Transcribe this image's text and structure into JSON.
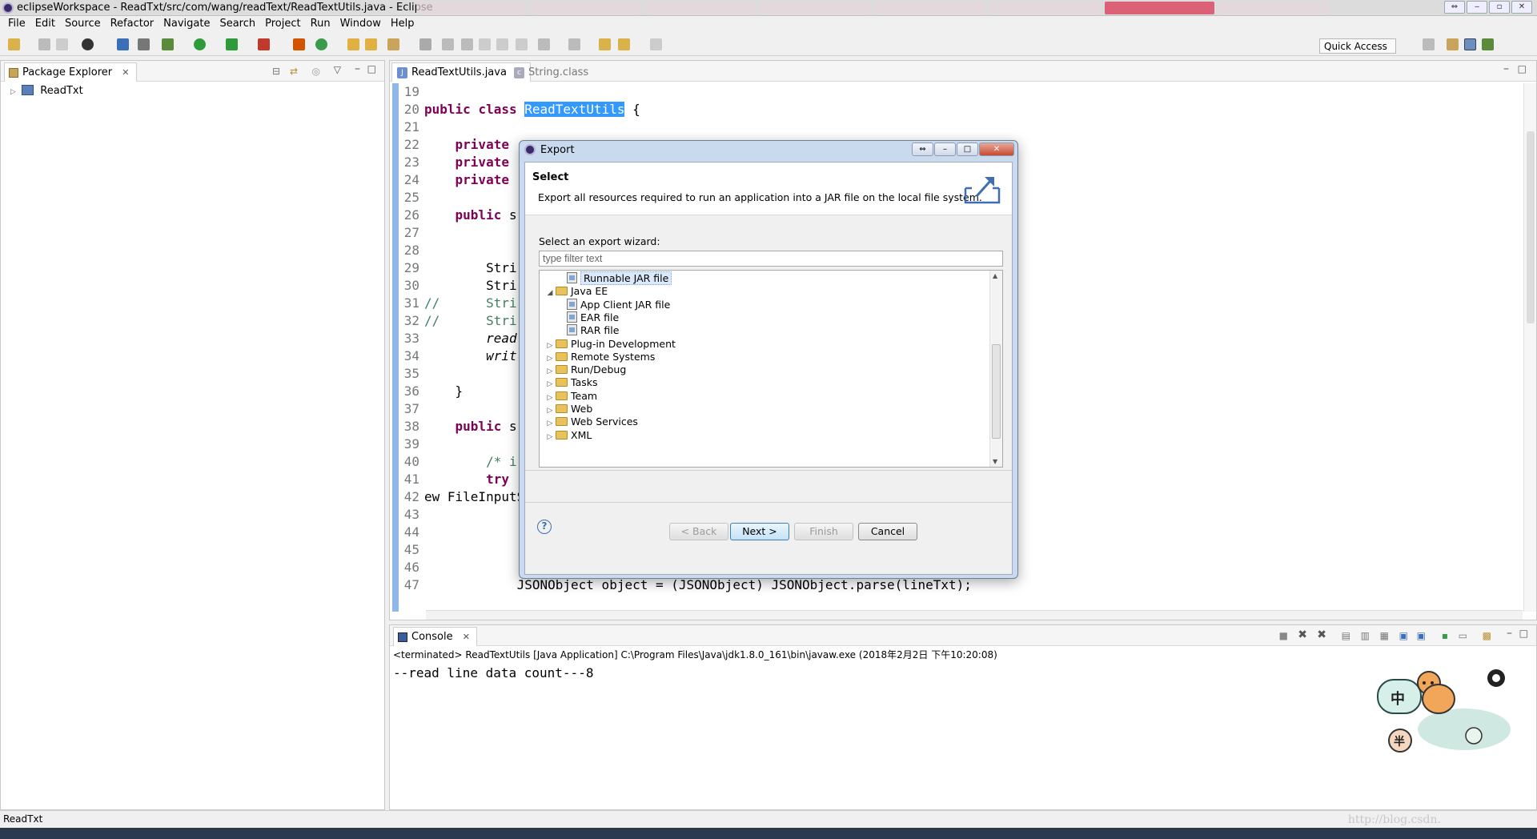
{
  "window": {
    "title": "eclipseWorkspace - ReadTxt/src/com/wang/readText/ReadTextUtils.java - Eclipse"
  },
  "menu": [
    "File",
    "Edit",
    "Source",
    "Refactor",
    "Navigate",
    "Search",
    "Project",
    "Run",
    "Window",
    "Help"
  ],
  "toolbar": {
    "quick_access": "Quick Access"
  },
  "package_explorer": {
    "tab_label": "Package Explorer",
    "project": "ReadTxt"
  },
  "editor": {
    "tabs": [
      {
        "label": "ReadTextUtils.java",
        "active": true
      },
      {
        "label": "String.class",
        "active": false
      }
    ],
    "lines": [
      {
        "n": "19",
        "t": ""
      },
      {
        "n": "20",
        "t": "public class ReadTextUtils {"
      },
      {
        "n": "21",
        "t": ""
      },
      {
        "n": "22",
        "t": "    private"
      },
      {
        "n": "23",
        "t": "    private"
      },
      {
        "n": "24",
        "t": "    private"
      },
      {
        "n": "25",
        "t": ""
      },
      {
        "n": "26",
        "t": "    public s"
      },
      {
        "n": "27",
        "t": ""
      },
      {
        "n": "28",
        "t": ""
      },
      {
        "n": "29",
        "t": "        Stri"
      },
      {
        "n": "30",
        "t": "        Stri"
      },
      {
        "n": "31",
        "t": "//      Stri"
      },
      {
        "n": "32",
        "t": "//      Stri"
      },
      {
        "n": "33",
        "t": "        read"
      },
      {
        "n": "34",
        "t": "        writ"
      },
      {
        "n": "35",
        "t": ""
      },
      {
        "n": "36",
        "t": "    }"
      },
      {
        "n": "37",
        "t": ""
      },
      {
        "n": "38",
        "t": "    public s"
      },
      {
        "n": "39",
        "t": ""
      },
      {
        "n": "40",
        "t": "        /* i"
      },
      {
        "n": "41",
        "t": "        try"
      },
      {
        "n": "42",
        "t": "ew FileInputStream(new File(srcPath)),\"UTF-16LE\"));"
      },
      {
        "n": "43",
        "t": ""
      },
      {
        "n": "44",
        "t": ""
      },
      {
        "n": "45",
        "t": ""
      },
      {
        "n": "46",
        "t": ""
      },
      {
        "n": "47",
        "t": "            JSONObject object = (JSONObject) JSONObject.parse(lineTxt);"
      }
    ]
  },
  "console": {
    "tab_label": "Console",
    "status": "<terminated> ReadTextUtils [Java Application] C:\\Program Files\\Java\\jdk1.8.0_161\\bin\\javaw.exe (2018年2月2日 下午10:20:08)",
    "output": "--read line data count---8"
  },
  "statusbar": {
    "selection": "ReadTxt",
    "watermark": "http://blog.csdn."
  },
  "dialog": {
    "title": "Export",
    "header_title": "Select",
    "header_desc": "Export all resources required to run an application into a JAR file on the local file system.",
    "wizard_label": "Select an export wizard:",
    "filter_placeholder": "type filter text",
    "tree": [
      {
        "label": "Runnable JAR file",
        "kind": "jar",
        "depth": 2,
        "twisty": "",
        "selected": true
      },
      {
        "label": "Java EE",
        "kind": "folder",
        "depth": 1,
        "twisty": "open",
        "selected": false
      },
      {
        "label": "App Client JAR file",
        "kind": "jar",
        "depth": 2,
        "twisty": "",
        "selected": false
      },
      {
        "label": "EAR file",
        "kind": "jar",
        "depth": 2,
        "twisty": "",
        "selected": false
      },
      {
        "label": "RAR file",
        "kind": "jar",
        "depth": 2,
        "twisty": "",
        "selected": false
      },
      {
        "label": "Plug-in Development",
        "kind": "folder",
        "depth": 1,
        "twisty": "closed",
        "selected": false
      },
      {
        "label": "Remote Systems",
        "kind": "folder",
        "depth": 1,
        "twisty": "closed",
        "selected": false
      },
      {
        "label": "Run/Debug",
        "kind": "folder",
        "depth": 1,
        "twisty": "closed",
        "selected": false
      },
      {
        "label": "Tasks",
        "kind": "folder",
        "depth": 1,
        "twisty": "closed",
        "selected": false
      },
      {
        "label": "Team",
        "kind": "folder",
        "depth": 1,
        "twisty": "closed",
        "selected": false
      },
      {
        "label": "Web",
        "kind": "folder",
        "depth": 1,
        "twisty": "closed",
        "selected": false
      },
      {
        "label": "Web Services",
        "kind": "folder",
        "depth": 1,
        "twisty": "closed",
        "selected": false
      },
      {
        "label": "XML",
        "kind": "folder",
        "depth": 1,
        "twisty": "closed",
        "selected": false
      }
    ],
    "buttons": {
      "back": "< Back",
      "next": "Next >",
      "finish": "Finish",
      "cancel": "Cancel"
    }
  }
}
